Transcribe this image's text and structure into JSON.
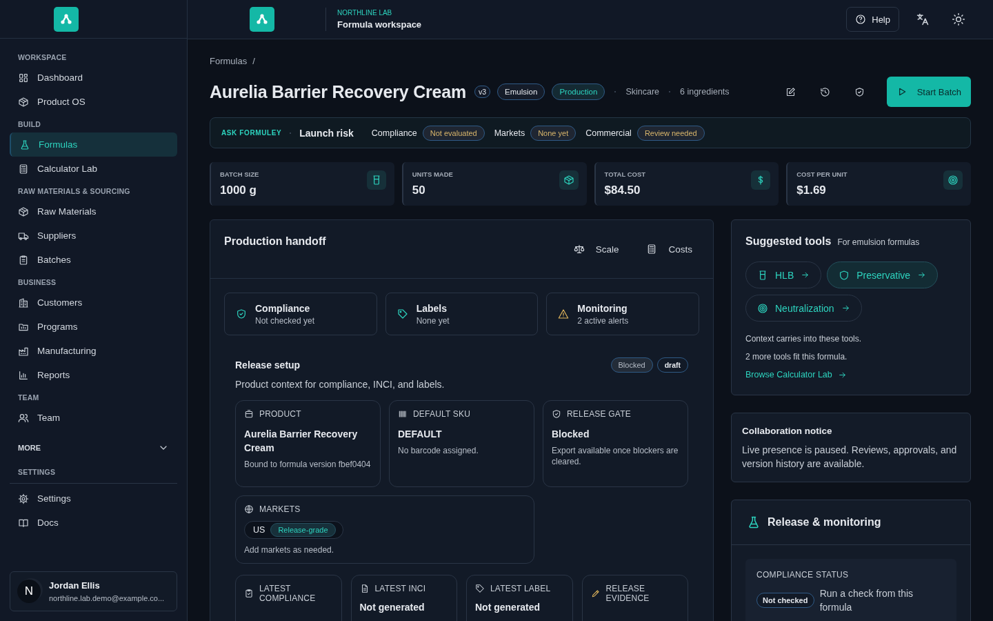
{
  "sidebar": {
    "sections": [
      {
        "title": "WORKSPACE",
        "items": [
          {
            "label": "Dashboard",
            "selected": false
          },
          {
            "label": "Product OS",
            "selected": false
          }
        ]
      },
      {
        "title": "BUILD",
        "items": [
          {
            "label": "Formulas",
            "selected": true
          },
          {
            "label": "Calculator Lab",
            "selected": false
          }
        ]
      },
      {
        "title": "RAW MATERIALS & SOURCING",
        "items": [
          {
            "label": "Raw Materials",
            "selected": false
          },
          {
            "label": "Suppliers",
            "selected": false
          },
          {
            "label": "Batches",
            "selected": false
          }
        ]
      },
      {
        "title": "BUSINESS",
        "items": [
          {
            "label": "Customers",
            "selected": false
          },
          {
            "label": "Programs",
            "selected": false
          },
          {
            "label": "Manufacturing",
            "selected": false
          },
          {
            "label": "Reports",
            "selected": false
          }
        ]
      },
      {
        "title": "TEAM",
        "items": [
          {
            "label": "Team",
            "selected": false
          }
        ]
      }
    ],
    "more": {
      "label": "MORE",
      "expanded": false
    },
    "settings": {
      "title": "SETTINGS",
      "items": [
        {
          "label": "Settings",
          "selected": false
        },
        {
          "label": "Docs",
          "selected": false
        }
      ]
    },
    "user": {
      "initial": "N",
      "name": "Jordan Ellis",
      "email": "northline.lab.demo@example.co..."
    }
  },
  "topbar": {
    "org": "NORTHLINE LAB",
    "title": "Formula workspace",
    "help": "Help"
  },
  "breadcrumb": {
    "items": [
      "Formulas"
    ],
    "separator": "/"
  },
  "header": {
    "title": "Aurelia Barrier Recovery Cream",
    "version": "v3",
    "tags": [
      {
        "label": "Emulsion",
        "kind": "neutral"
      },
      {
        "label": "Production",
        "kind": "accent"
      }
    ],
    "meta": [
      "Skincare",
      "6 ingredients"
    ],
    "action": "Start Batch"
  },
  "risk_bar": {
    "label": "ASK FORMULEY",
    "title": "Launch risk",
    "items": [
      {
        "label": "Compliance",
        "status": "Not evaluated"
      },
      {
        "label": "Markets",
        "status": "None yet"
      },
      {
        "label": "Commercial",
        "status": "Review needed"
      }
    ]
  },
  "stats": [
    {
      "label": "BATCH SIZE",
      "value": "1000 g"
    },
    {
      "label": "UNITS MADE",
      "value": "50"
    },
    {
      "label": "TOTAL COST",
      "value": "$84.50"
    },
    {
      "label": "COST PER UNIT",
      "value": "$1.69"
    }
  ],
  "handoff": {
    "title": "Production handoff",
    "actions": [
      "Scale",
      "Costs"
    ],
    "status_cards": [
      {
        "title": "Compliance",
        "subtitle": "Not checked yet",
        "kind": "ok"
      },
      {
        "title": "Labels",
        "subtitle": "None yet",
        "kind": "ok"
      },
      {
        "title": "Monitoring",
        "subtitle": "2 active alerts",
        "kind": "warn"
      }
    ],
    "release_setup": {
      "title": "Release setup",
      "description": "Product context for compliance, INCI, and labels.",
      "badges": [
        {
          "label": "Blocked",
          "kind": "warn"
        },
        {
          "label": "draft",
          "kind": "neutral"
        }
      ],
      "cards": [
        {
          "label": "PRODUCT",
          "value": "Aurelia Barrier Recovery Cream",
          "note": "Bound to formula version fbef0404"
        },
        {
          "label": "DEFAULT SKU",
          "value": "DEFAULT",
          "note": "No barcode assigned."
        },
        {
          "label": "RELEASE GATE",
          "value": "Blocked",
          "note": "Export available once blockers are cleared."
        }
      ],
      "markets": {
        "label": "MARKETS",
        "items": [
          {
            "code": "US",
            "grade": "Release-grade"
          }
        ],
        "note": "Add markets as needed."
      },
      "bottom_cards": [
        {
          "label": "LATEST COMPLIANCE"
        },
        {
          "label": "LATEST INCI",
          "value": "Not generated"
        },
        {
          "label": "LATEST LABEL",
          "value": "Not generated"
        },
        {
          "label": "RELEASE EVIDENCE"
        }
      ]
    }
  },
  "suggested_tools": {
    "title": "Suggested tools",
    "subtitle": "For emulsion formulas",
    "tools": [
      {
        "label": "HLB",
        "selected": false
      },
      {
        "label": "Preservative",
        "selected": true
      },
      {
        "label": "Neutralization",
        "selected": false
      }
    ],
    "notes": [
      "Context carries into these tools.",
      "2 more tools fit this formula."
    ],
    "link": "Browse Calculator Lab"
  },
  "collaboration": {
    "title": "Collaboration notice",
    "text": "Live presence is paused. Reviews, approvals, and version history are available."
  },
  "release_monitoring": {
    "title": "Release & monitoring",
    "compliance_status": {
      "label": "COMPLIANCE STATUS",
      "badge": "Not checked",
      "text": "Run a check from this formula"
    }
  }
}
